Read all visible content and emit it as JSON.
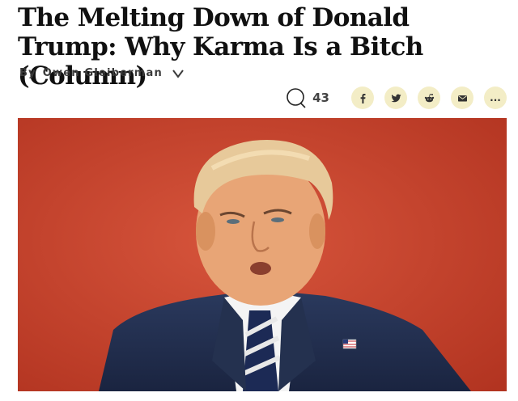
{
  "article": {
    "headline": "The Melting Down of Donald Trump: Why Karma Is a Bitch (Column)",
    "byline_prefix": "By",
    "author": "Owen Gleiberman"
  },
  "social": {
    "comment_count": "43",
    "share_buttons": [
      {
        "name": "facebook",
        "icon": "facebook-icon"
      },
      {
        "name": "twitter",
        "icon": "twitter-icon"
      },
      {
        "name": "reddit",
        "icon": "reddit-icon"
      },
      {
        "name": "email",
        "icon": "email-icon"
      },
      {
        "name": "more",
        "icon": "more-icon",
        "label": "..."
      }
    ],
    "button_color": "#f3edc6"
  },
  "hero_image": {
    "background_color": "#c8432f"
  }
}
